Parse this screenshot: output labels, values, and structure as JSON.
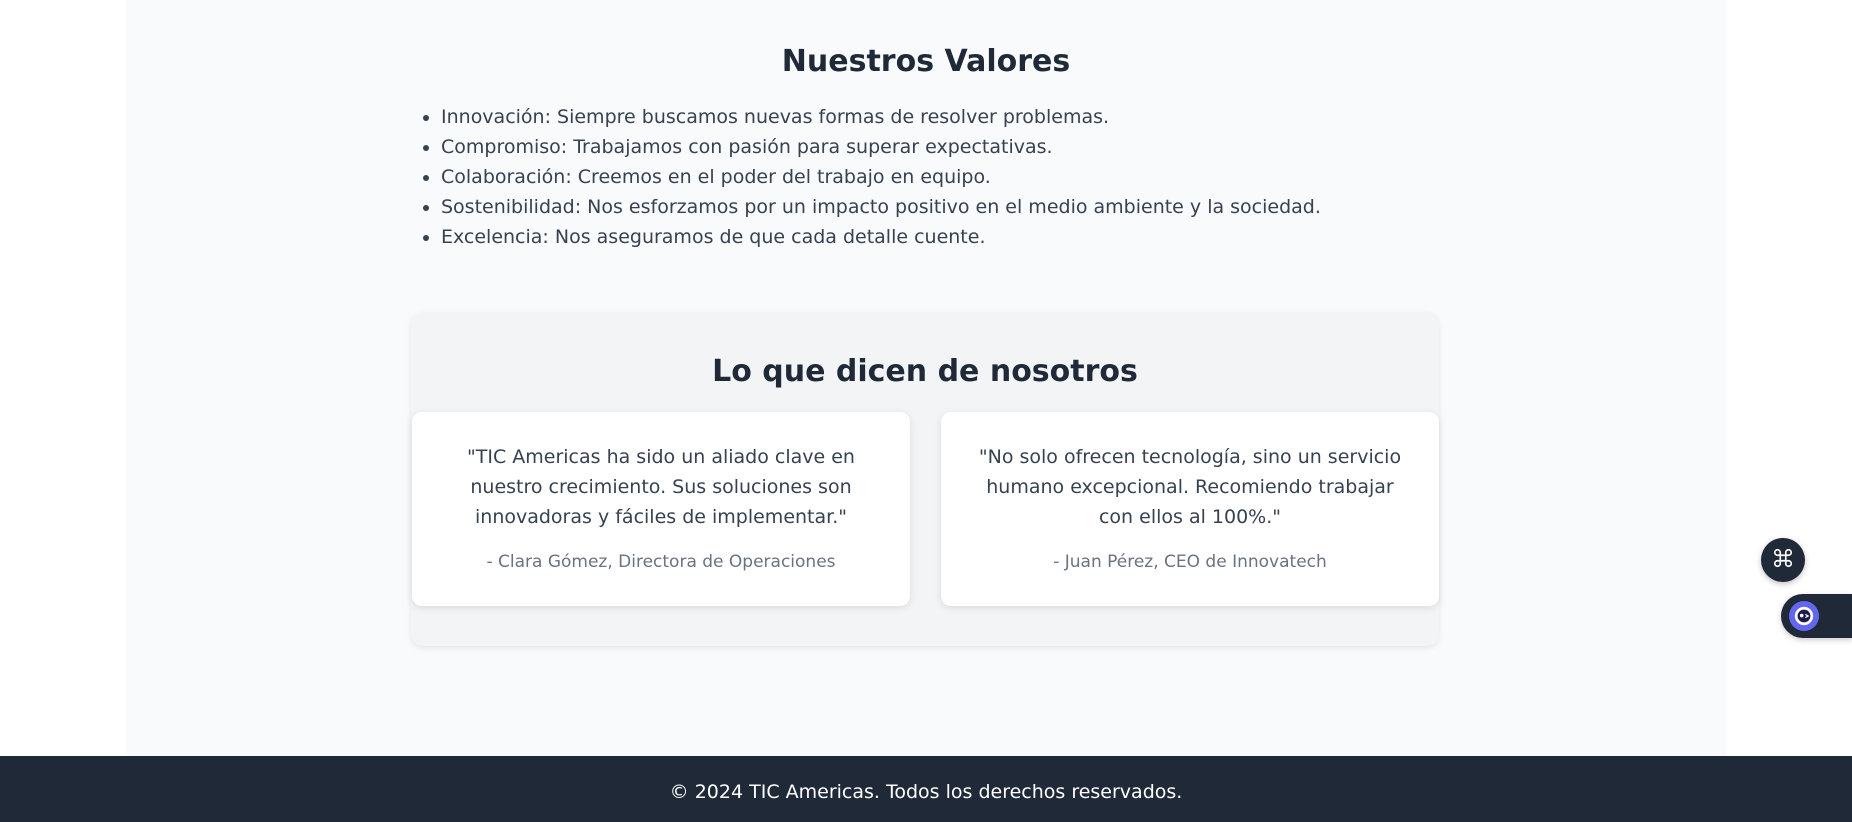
{
  "values": {
    "title": "Nuestros Valores",
    "items": [
      "Innovación: Siempre buscamos nuevas formas de resolver problemas.",
      "Compromiso: Trabajamos con pasión para superar expectativas.",
      "Colaboración: Creemos en el poder del trabajo en equipo.",
      "Sostenibilidad: Nos esforzamos por un impacto positivo en el medio ambiente y la sociedad.",
      "Excelencia: Nos aseguramos de que cada detalle cuente."
    ]
  },
  "testimonials": {
    "title": "Lo que dicen de nosotros",
    "items": [
      {
        "quote": "\"TIC Americas ha sido un aliado clave en nuestro crecimiento. Sus soluciones son innovadoras y fáciles de implementar.\"",
        "author": "- Clara Gómez, Directora de Operaciones"
      },
      {
        "quote": "\"No solo ofrecen tecnología, sino un servicio humano excepcional. Recomiendo trabajar con ellos al 100%.\"",
        "author": "- Juan Pérez, CEO de Innovatech"
      }
    ]
  },
  "footer": {
    "copyright": "© 2024 TIC Americas. Todos los derechos reservados."
  },
  "widgets": {
    "command_icon": "command-icon",
    "assistant_icon": "assistant-icon"
  },
  "colors": {
    "page_bg": "#f9fafb",
    "footer_bg": "#1f2937",
    "accent": "#6366f1"
  }
}
